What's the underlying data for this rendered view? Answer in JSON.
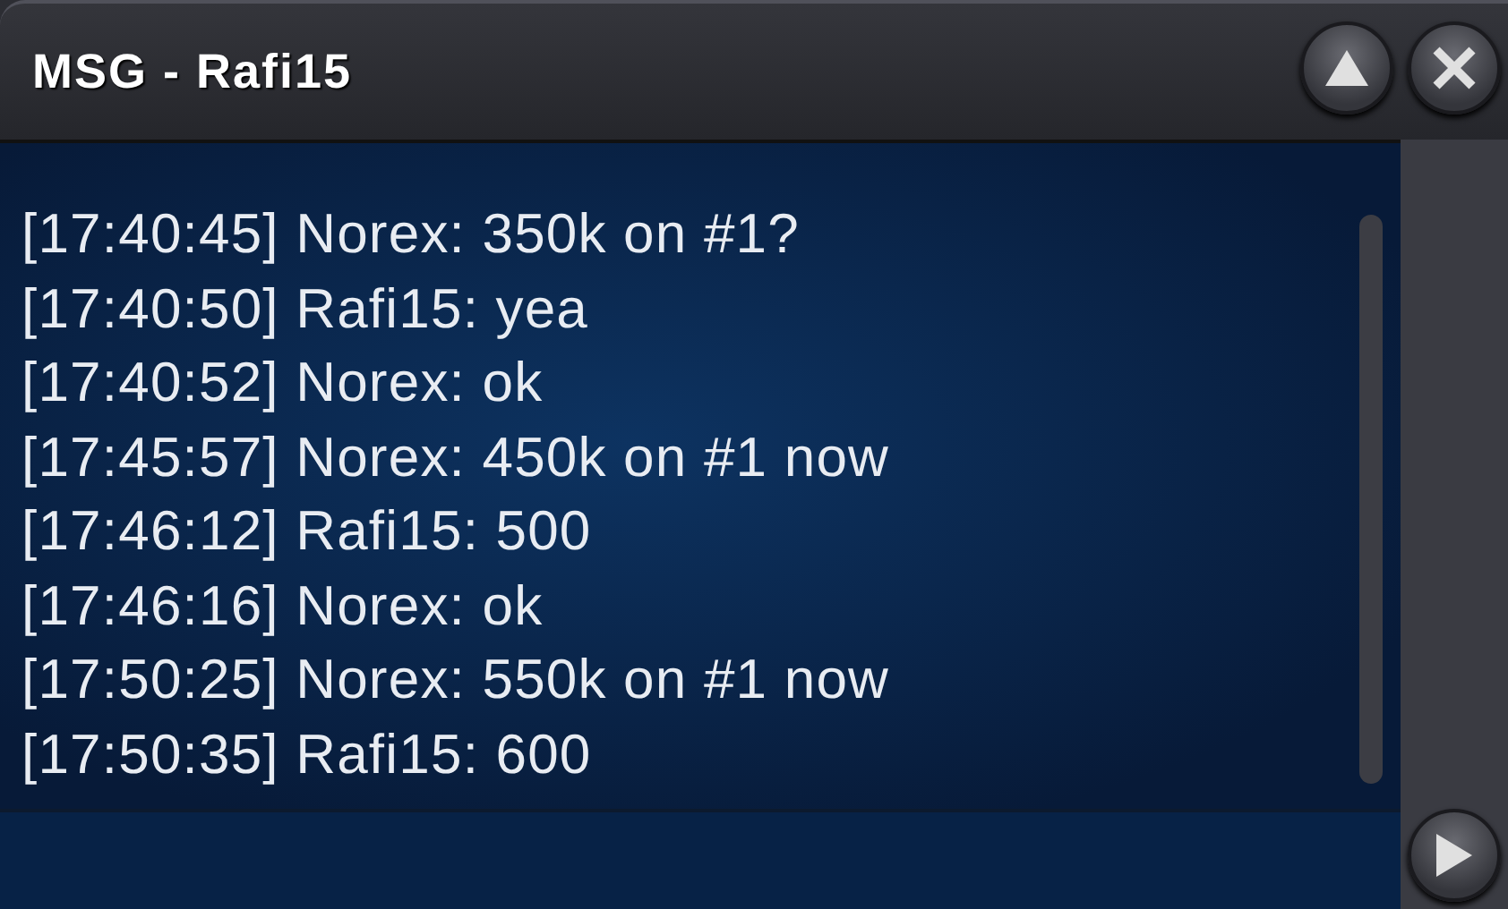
{
  "window": {
    "title": "MSG - Rafi15"
  },
  "messages": [
    "[17:40:45] Norex: 350k on #1?",
    "[17:40:50] Rafi15: yea",
    "[17:40:52] Norex: ok",
    "[17:45:57] Norex: 450k on #1 now",
    "[17:46:12] Rafi15: 500",
    "[17:46:16] Norex: ok",
    "[17:50:25] Norex: 550k on #1 now",
    "[17:50:35] Rafi15: 600"
  ]
}
